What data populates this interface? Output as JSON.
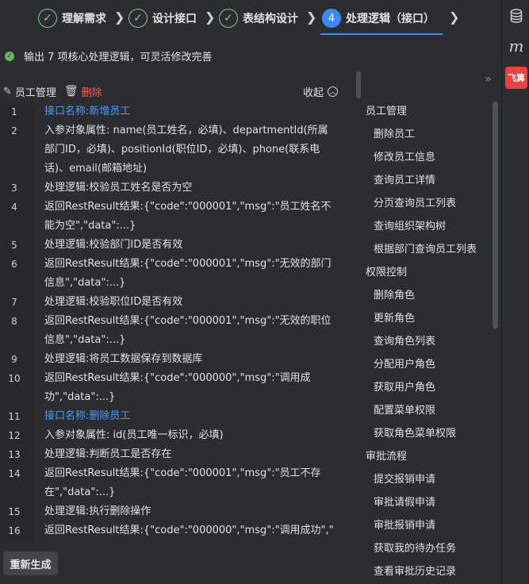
{
  "stepper": {
    "steps": [
      {
        "label": "理解需求",
        "status": "done",
        "mark": "✓"
      },
      {
        "label": "设计接口",
        "status": "done",
        "mark": "✓"
      },
      {
        "label": "表结构设计",
        "status": "done",
        "mark": "✓"
      },
      {
        "label": "处理逻辑（接口）",
        "status": "active",
        "mark": "4"
      }
    ]
  },
  "status": {
    "text": "输出 7 项核心处理逻辑，可灵活修改完善",
    "color": "#5fb85a"
  },
  "module": {
    "name": "员工管理",
    "delete_label": "删除",
    "collapse_label": "收起"
  },
  "code_lines": [
    {
      "num": "1",
      "text": "接口名称:新增员工",
      "type": "title"
    },
    {
      "num": "2",
      "text": "入参对象属性: name(员工姓名，必填)、departmentId(所属部门ID，必填)、positionId(职位ID，必填)、phone(联系电话)、email(邮箱地址)",
      "type": "text"
    },
    {
      "num": "3",
      "text": "处理逻辑:校验员工姓名是否为空",
      "type": "text"
    },
    {
      "num": "4",
      "text": "返回RestResult结果:{\"code\":\"000001\",\"msg\":\"员工姓名不能为空\",\"data\":...}",
      "type": "text"
    },
    {
      "num": "5",
      "text": "处理逻辑:校验部门ID是否有效",
      "type": "text"
    },
    {
      "num": "6",
      "text": "返回RestResult结果:{\"code\":\"000001\",\"msg\":\"无效的部门信息\",\"data\":...}",
      "type": "text"
    },
    {
      "num": "7",
      "text": "处理逻辑:校验职位ID是否有效",
      "type": "text"
    },
    {
      "num": "8",
      "text": "返回RestResult结果:{\"code\":\"000001\",\"msg\":\"无效的职位信息\",\"data\":...}",
      "type": "text"
    },
    {
      "num": "9",
      "text": "处理逻辑:将员工数据保存到数据库",
      "type": "text"
    },
    {
      "num": "10",
      "text": "返回RestResult结果:{\"code\":\"000000\",\"msg\":\"调用成功\",\"data\":...}",
      "type": "text"
    },
    {
      "num": "11",
      "text": "接口名称:删除员工",
      "type": "title"
    },
    {
      "num": "12",
      "text": "入参对象属性: id(员工唯一标识，必填)",
      "type": "text"
    },
    {
      "num": "13",
      "text": "处理逻辑:判断员工是否存在",
      "type": "text"
    },
    {
      "num": "14",
      "text": "返回RestResult结果:{\"code\":\"000001\",\"msg\":\"员工不存在\",\"data\":...}",
      "type": "text"
    },
    {
      "num": "15",
      "text": "处理逻辑:执行删除操作",
      "type": "text"
    },
    {
      "num": "16",
      "text": "返回RestResult结果:{\"code\":\"000000\",\"msg\":\"调用成功\",\"",
      "type": "text"
    }
  ],
  "regen_label": "重新生成",
  "tree": [
    {
      "label": "员工管理",
      "level": "group"
    },
    {
      "label": "删除员工",
      "level": "child"
    },
    {
      "label": "修改员工信息",
      "level": "child"
    },
    {
      "label": "查询员工详情",
      "level": "child"
    },
    {
      "label": "分页查询员工列表",
      "level": "child"
    },
    {
      "label": "查询组织架构树",
      "level": "child"
    },
    {
      "label": "根据部门查询员工列表",
      "level": "child"
    },
    {
      "label": "权限控制",
      "level": "group"
    },
    {
      "label": "删除角色",
      "level": "child"
    },
    {
      "label": "更新角色",
      "level": "child"
    },
    {
      "label": "查询角色列表",
      "level": "child"
    },
    {
      "label": "分配用户角色",
      "level": "child"
    },
    {
      "label": "获取用户角色",
      "level": "child"
    },
    {
      "label": "配置菜单权限",
      "level": "child"
    },
    {
      "label": "获取角色菜单权限",
      "level": "child"
    },
    {
      "label": "审批流程",
      "level": "group"
    },
    {
      "label": "提交报销申请",
      "level": "child"
    },
    {
      "label": "审批请假申请",
      "level": "child"
    },
    {
      "label": "审批报销申请",
      "level": "child"
    },
    {
      "label": "获取我的待办任务",
      "level": "child"
    },
    {
      "label": "查看审批历史记录",
      "level": "child"
    }
  ],
  "toolbar": {
    "database_icon": "database-icon",
    "m_label": "m",
    "fly_label": "飞算"
  },
  "colors": {
    "accent": "#3d8bf2",
    "done": "#8fc78a",
    "danger": "#e5675f",
    "link": "#4a9df5"
  }
}
